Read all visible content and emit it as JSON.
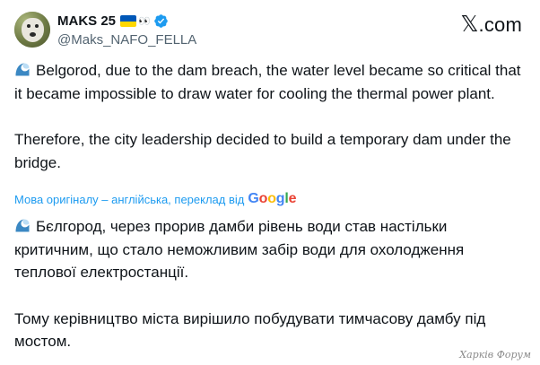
{
  "author": {
    "display_name": "MAKS 25",
    "eyes_emoji": "👀",
    "handle": "@Maks_NAFO_FELLA"
  },
  "brand": {
    "x_mark": "𝕏",
    "dotcom": ".com"
  },
  "tweet_en": {
    "para1": "Belgorod, due to the dam breach, the water level became so critical that it became impossible to draw water for cooling the thermal power plant.",
    "para2": "Therefore, the city leadership decided to build a temporary dam under the bridge."
  },
  "translation": {
    "label": "Мова оригіналу – англійська, переклад від",
    "google": {
      "g1": "G",
      "o1": "o",
      "o2": "o",
      "g2": "g",
      "l": "l",
      "e": "e"
    }
  },
  "tweet_uk": {
    "para1": "Бєлгород, через прорив дамби рівень води став настільки критичним, що стало неможливим забір води для охолодження теплової електростанції.",
    "para2": "Тому керівництво міста вирішило побудувати тимчасову дамбу під мостом."
  },
  "watermark": "Харків Форум",
  "colors": {
    "link_blue": "#1d9bf0",
    "text": "#0f1419",
    "secondary": "#536471"
  }
}
